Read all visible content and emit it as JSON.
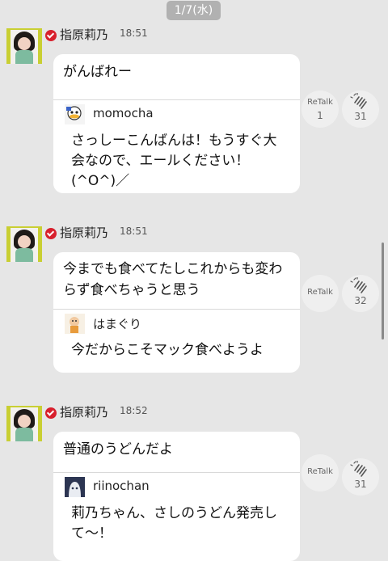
{
  "date_header": "1/7(水)",
  "messages": [
    {
      "author": "指原莉乃",
      "time": "18:51",
      "text": "がんばれー",
      "quote": {
        "name": "momocha",
        "text": "さっしーこんばんは！もうすぐ大会なので、エールください！(^O^)／"
      },
      "retalk_label": "ReTalk",
      "retalk_count": "1",
      "clap_count": "31"
    },
    {
      "author": "指原莉乃",
      "time": "18:51",
      "text": "今までも食べてたしこれからも変わらず食べちゃうと思う",
      "quote": {
        "name": "はまぐり",
        "text": "今だからこそマック食べようよ"
      },
      "retalk_label": "ReTalk",
      "retalk_count": "",
      "clap_count": "32"
    },
    {
      "author": "指原莉乃",
      "time": "18:52",
      "text": "普通のうどんだよ",
      "quote": {
        "name": "riinochan",
        "text": "莉乃ちゃん、さしのうどん発売して〜！"
      },
      "retalk_label": "ReTalk",
      "retalk_count": "",
      "clap_count": "31"
    }
  ],
  "colors": {
    "background": "#e6e6e6",
    "badge": "#d8202d",
    "avatar_frame": "#c9cf33"
  },
  "icons": {
    "verified": "check-badge-icon",
    "clap": "clap-hands-icon"
  }
}
